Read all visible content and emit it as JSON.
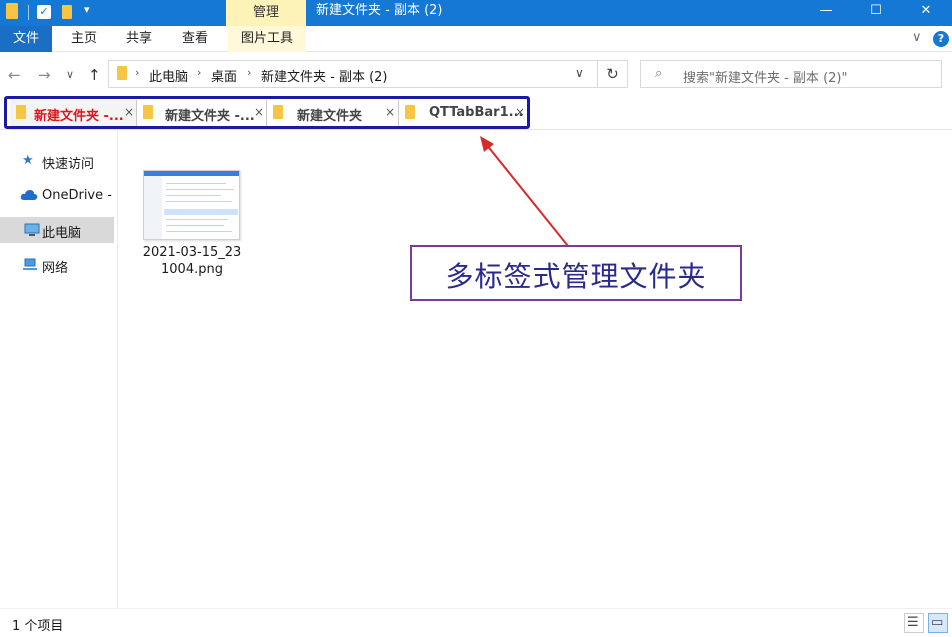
{
  "window": {
    "title": "新建文件夹 - 副本 (2)",
    "context_tab": "管理",
    "controls": {
      "minimize": "—",
      "maximize": "☐",
      "close": "✕"
    },
    "accent_color": "#1478d4",
    "quick_access_dropdown": "▾"
  },
  "ribbon": {
    "file_tab": "文件",
    "tabs": [
      "主页",
      "共享",
      "查看",
      "图片工具"
    ],
    "expand_chevron": "∨",
    "help": "?"
  },
  "address": {
    "back": "←",
    "forward": "→",
    "recent": "∨",
    "up": "↑",
    "breadcrumb": [
      "此电脑",
      "桌面",
      "新建文件夹 - 副本 (2)"
    ],
    "dropdown": "∨",
    "refresh": "↻",
    "search_placeholder": "搜索\"新建文件夹 - 副本 (2)\""
  },
  "qttabs": [
    {
      "label": "新建文件夹 -...",
      "active": true
    },
    {
      "label": "新建文件夹 -...",
      "active": false
    },
    {
      "label": "新建文件夹",
      "active": false
    },
    {
      "label": "QTTabBar1...",
      "active": false
    }
  ],
  "tab_close": "×",
  "tabbar_highlight_color": "#1a1aa6",
  "sidebar": [
    {
      "label": "快速访问",
      "icon": "star-icon",
      "selected": false
    },
    {
      "label": "OneDrive -",
      "icon": "cloud-icon",
      "selected": false
    },
    {
      "label": "此电脑",
      "icon": "computer-icon",
      "selected": true
    },
    {
      "label": "网络",
      "icon": "network-icon",
      "selected": false
    }
  ],
  "files": [
    {
      "name_line1": "2021-03-15_23",
      "name_line2": "1004.png",
      "icon": "image-thumbnail"
    }
  ],
  "annotation": {
    "text": "多标签式管理文件夹",
    "arrow_color": "#d62b2b",
    "border_color": "#7a3a9a"
  },
  "status": {
    "item_count": "1 个项目"
  }
}
